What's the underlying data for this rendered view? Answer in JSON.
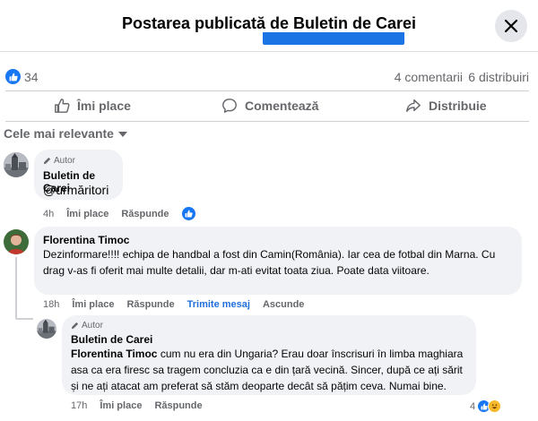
{
  "header": {
    "title": "Postarea publicată de Buletin de Carei"
  },
  "reactions": {
    "count": "34",
    "comments": "4 comentarii",
    "shares": "6 distribuiri"
  },
  "actions": {
    "like": "Îmi place",
    "comment": "Comentează",
    "share": "Distribuie"
  },
  "sort": {
    "label": "Cele mai relevante"
  },
  "comments": [
    {
      "author_tag": "Autor",
      "name": "Buletin de Carei",
      "text": "@urmăritori",
      "time": "4h",
      "like_label": "Îmi place",
      "reply_label": "Răspunde"
    },
    {
      "name": "Florentina Timoc",
      "text": "Dezinformare!!!! echipa de handbal a fost din Camin(România). Iar cea de fotbal din Marna. Cu drag v-as fi oferit mai multe detalii, dar m-ati evitat toata ziua. Poate data viitoare.",
      "time": "18h",
      "like_label": "Îmi place",
      "reply_label": "Răspunde",
      "message_label": "Trimite mesaj",
      "hide_label": "Ascunde"
    },
    {
      "author_tag": "Autor",
      "name": "Buletin de Carei",
      "mention": "Florentina Timoc",
      "text": "cum nu era din Ungaria? Erau doar înscrisuri în limba maghiara asa ca era firesc sa tragem concluzia ca e din țară vecină. Sincer, după ce ați sărit și ne ați atacat am preferat să stăm deoparte decât să pățim ceva. Numai bine.",
      "time": "17h",
      "like_label": "Îmi place",
      "reply_label": "Răspunde",
      "reaction_count": "4"
    }
  ],
  "colors": {
    "accent": "#1877f2",
    "bubble": "#f0f2f5",
    "secondary_text": "#65676b"
  }
}
